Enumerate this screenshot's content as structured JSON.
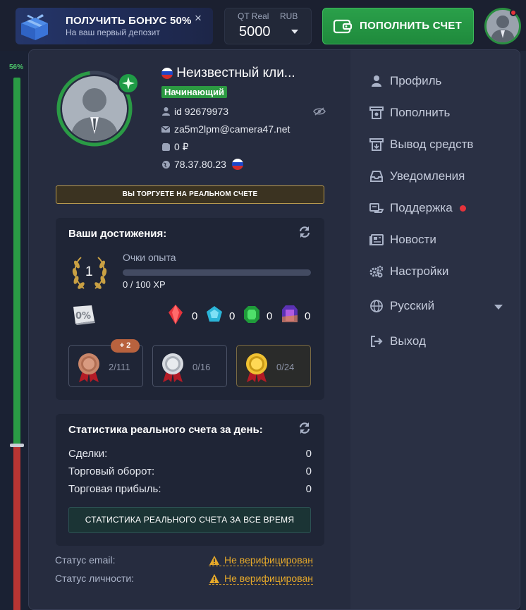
{
  "topbar": {
    "bonus_title": "ПОЛУЧИТЬ БОНУС 50%",
    "bonus_subtitle": "На ваш первый депозит",
    "bonus_close": "×",
    "account_label": "QT Real",
    "account_currency": "RUB",
    "account_balance": "5000",
    "deposit_label": "ПОПОЛНИТЬ СЧЕТ"
  },
  "background": {
    "sentiment_percent": "56%"
  },
  "profile": {
    "name": "Неизвестный кли...",
    "level": "Начинающий",
    "id": "id 92679973",
    "email": "za5m2lpm@camera47.net",
    "balance": "0 ₽",
    "ip": "78.37.80.23",
    "real_account_banner": "ВЫ ТОРГУЕТЕ НА РЕАЛЬНОМ СЧЕТЕ"
  },
  "achievements": {
    "title": "Ваши достижения:",
    "level_number": "1",
    "xp_label": "Очки опыта",
    "xp_value": "0 / 100 XP",
    "xp_progress": 0,
    "discount_icon_text": "0%",
    "gems": [
      {
        "name": "red-gem-icon",
        "value": "0",
        "color": "#e5333b"
      },
      {
        "name": "blue-gem-icon",
        "value": "0",
        "color": "#2bb5d8"
      },
      {
        "name": "green-gem-icon",
        "value": "0",
        "color": "#2fc04a"
      },
      {
        "name": "purple-gem-icon",
        "value": "0",
        "color": "#7a4bd6"
      }
    ],
    "medals": [
      {
        "name": "bronze-medal",
        "value": "2/111",
        "badge": "+ 2"
      },
      {
        "name": "silver-medal",
        "value": "0/16"
      },
      {
        "name": "gold-medal",
        "value": "0/24"
      }
    ]
  },
  "daily_stats": {
    "title": "Статистика реального счета за день:",
    "rows": [
      {
        "label": "Сделки:",
        "value": "0"
      },
      {
        "label": "Торговый оборот:",
        "value": "0"
      },
      {
        "label": "Торговая прибыль:",
        "value": "0"
      }
    ],
    "all_time_button": "СТАТИСТИКА РЕАЛЬНОГО СЧЕТА ЗА ВСЕ ВРЕМЯ"
  },
  "verification": {
    "email_label": "Статус email:",
    "email_status": "Не верифицирован",
    "identity_label": "Статус личности:",
    "identity_status": "Не верифицирован"
  },
  "menu": {
    "items": [
      {
        "label": "Профиль",
        "icon": "user-icon"
      },
      {
        "label": "Пополнить",
        "icon": "deposit-icon"
      },
      {
        "label": "Вывод средств",
        "icon": "withdraw-icon"
      },
      {
        "label": "Уведомления",
        "icon": "inbox-icon"
      },
      {
        "label": "Поддержка",
        "icon": "support-icon"
      },
      {
        "label": "Новости",
        "icon": "news-icon"
      },
      {
        "label": "Настройки",
        "icon": "gears-icon"
      },
      {
        "label": "Русский",
        "icon": "globe-icon"
      },
      {
        "label": "Выход",
        "icon": "logout-icon"
      }
    ]
  },
  "colors": {
    "accent_green": "#2a9b45",
    "warning": "#e6a92a",
    "alert_red": "#e5333b"
  }
}
